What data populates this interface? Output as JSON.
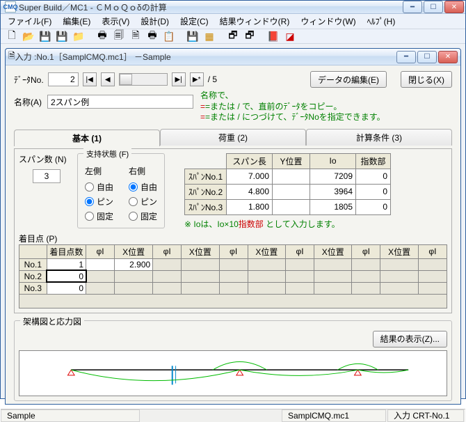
{
  "app": {
    "icon_text": "CMQ",
    "title": "Super Build／MC1 - ＣＭｏＱｏδの計算"
  },
  "menu": {
    "file": "ファイル(F)",
    "edit": "編集(E)",
    "view": "表示(V)",
    "design": "設計(D)",
    "settings": "設定(C)",
    "result": "結果ウィンドウ(R)",
    "window": "ウィンドウ(W)",
    "help": "ﾍﾙﾌﾟ(H)"
  },
  "inner": {
    "title": "入力 :No.1［SamplCMQ.mc1］ －Sample"
  },
  "dataNo": {
    "label": "ﾃﾞｰﾀNo.",
    "value": "2",
    "total": "/ 5"
  },
  "buttons": {
    "edit": "データの編集(E)",
    "close": "閉じる(X)",
    "showResult": "結果の表示(Z)..."
  },
  "name": {
    "label": "名称(A)",
    "value": "2スパン例"
  },
  "hint": {
    "l1": "名称で、",
    "l2a": "=または / で、直前のﾃﾞｰﾀをコピー。",
    "l2b": "=または / につづけて、ﾃﾞｰﾀNoを指定できます。"
  },
  "tabs": {
    "t1": "基本 (1)",
    "t2": "荷重 (2)",
    "t3": "計算条件 (3)"
  },
  "span": {
    "label": "スパン数 (N)",
    "value": "3",
    "support_label": "支持状態 (F)",
    "left": "左側",
    "right": "右側",
    "opt_free": "自由",
    "opt_pin": "ピン",
    "opt_fix": "固定"
  },
  "spanTable": {
    "h1": "スパン長",
    "h2": "Y位置",
    "h3": "Io",
    "h4": "指数部",
    "r1": {
      "n": "ｽﾊﾟﾝNo.1",
      "a": "7.000",
      "b": "",
      "c": "7209",
      "d": "0"
    },
    "r2": {
      "n": "ｽﾊﾟﾝNo.2",
      "a": "4.800",
      "b": "",
      "c": "3964",
      "d": "0"
    },
    "r3": {
      "n": "ｽﾊﾟﾝNo.3",
      "a": "1.800",
      "b": "",
      "c": "1805",
      "d": "0"
    }
  },
  "ioNote": {
    "a": "※ Ioは、Io×10",
    "b": "指数部",
    "c": " として入力します。"
  },
  "chaku": {
    "label": "着目点 (P)",
    "h_count": "着目点数",
    "h_phi": "φI",
    "h_x": "X位置",
    "r1": {
      "n": "No.1",
      "count": "1",
      "phi1": "",
      "x1": "2.900"
    },
    "r2": {
      "n": "No.2",
      "count": "0"
    },
    "r3": {
      "n": "No.3",
      "count": "0"
    }
  },
  "diagram": {
    "label": "架構図と応力図"
  },
  "status": {
    "left": "Sample",
    "mid": "SamplCMQ.mc1",
    "right": "入力 CRT-No.1"
  }
}
